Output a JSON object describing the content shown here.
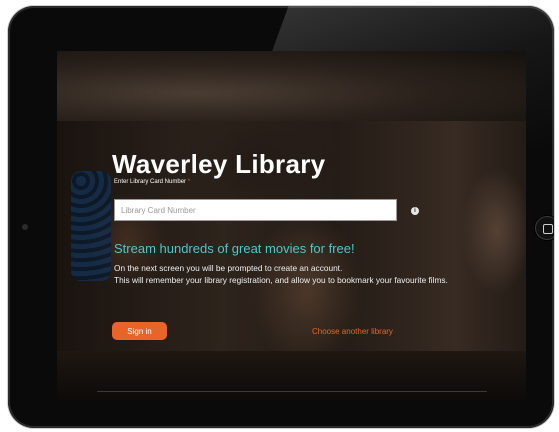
{
  "page": {
    "title": "Waverley Library",
    "card_label": "Enter Library Card Number",
    "required_mark": "*",
    "card_placeholder": "Library Card Number",
    "tagline": "Stream hundreds of great movies for free!",
    "description": [
      "On the next screen you will be prompted to create an account.",
      "This will remember your library registration, and allow you to bookmark your favourite films."
    ],
    "signin_label": "Sign in",
    "choose_library_label": "Choose another library"
  },
  "icons": {
    "info": "info-icon",
    "home": "home-button-icon"
  },
  "colors": {
    "accent": "#e8652a",
    "tagline": "#4fc6cc"
  }
}
